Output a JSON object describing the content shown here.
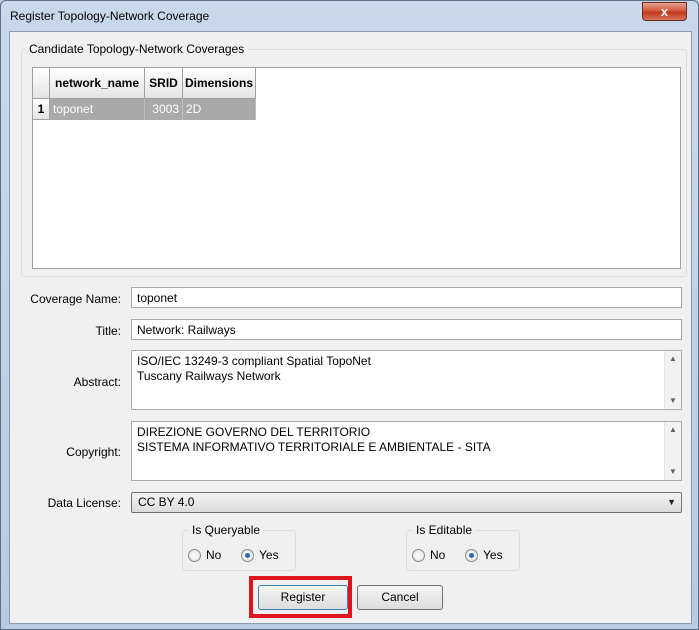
{
  "window": {
    "title": "Register Topology-Network Coverage",
    "close_label": "x"
  },
  "candidates": {
    "group_label": "Candidate Topology-Network Coverages",
    "columns": [
      "network_name",
      "SRID",
      "Dimensions"
    ],
    "rows": [
      {
        "index": "1",
        "network_name": "toponet",
        "srid": "3003",
        "dimensions": "2D"
      }
    ]
  },
  "form": {
    "coverage_name_label": "Coverage Name:",
    "coverage_name_value": "toponet",
    "title_label": "Title:",
    "title_value": "Network: Railways",
    "abstract_label": "Abstract:",
    "abstract_lines": [
      "ISO/IEC 13249-3 compliant Spatial TopoNet",
      "Tuscany Railways Network"
    ],
    "copyright_label": "Copyright:",
    "copyright_lines": [
      "DIREZIONE GOVERNO DEL TERRITORIO",
      "SISTEMA INFORMATIVO TERRITORIALE E AMBIENTALE - SITA"
    ],
    "license_label": "Data License:",
    "license_value": "CC BY 4.0"
  },
  "is_queryable": {
    "label": "Is Queryable",
    "no_label": "No",
    "yes_label": "Yes",
    "selected": "Yes"
  },
  "is_editable": {
    "label": "Is Editable",
    "no_label": "No",
    "yes_label": "Yes",
    "selected": "Yes"
  },
  "buttons": {
    "register_label": "Register",
    "cancel_label": "Cancel"
  },
  "colors": {
    "selected_row": "#a9a9a9",
    "highlight": "#e0141e"
  }
}
